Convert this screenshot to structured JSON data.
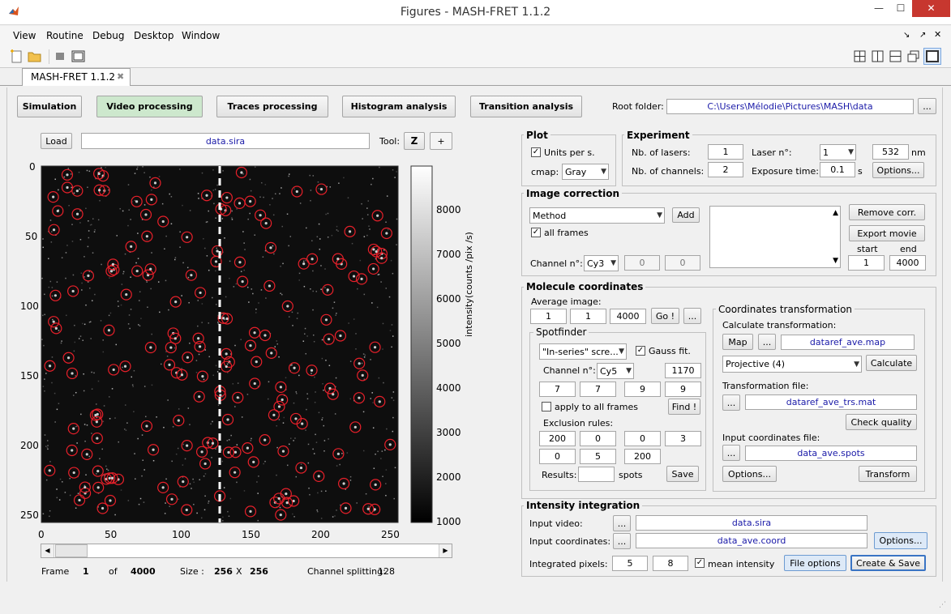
{
  "window": {
    "title": "Figures - MASH-FRET 1.1.2",
    "minimize": "—",
    "maximize": "☐",
    "close": "✕"
  },
  "menu": [
    "View",
    "Routine",
    "Debug",
    "Desktop",
    "Window"
  ],
  "document_tab": {
    "label": "MASH-FRET 1.1.2",
    "close": "✖"
  },
  "modules": {
    "items": [
      "Simulation",
      "Video processing",
      "Traces processing",
      "Histogram analysis",
      "Transition analysis"
    ],
    "selected": "Video processing",
    "root_label": "Root folder:",
    "root_value": "C:\\Users\\Mélodie\\Pictures\\MASH\\data",
    "root_browse": "..."
  },
  "viewer": {
    "load": "Load",
    "file": "data.sira",
    "tool_label": "Tool:",
    "tool_zoom": "Z",
    "tool_cross": "+",
    "y_ticks": [
      "0",
      "50",
      "100",
      "150",
      "200",
      "250"
    ],
    "x_ticks": [
      "0",
      "50",
      "100",
      "150",
      "200",
      "250"
    ],
    "colorbar_ticks": [
      "8000",
      "7000",
      "6000",
      "5000",
      "4000",
      "3000",
      "2000",
      "1000"
    ],
    "colorbar_label": "intensity(counts /pix /s)",
    "frame_label": "Frame",
    "frame_value": "1",
    "of_label": "of",
    "frame_total": "4000",
    "size_label": "Size :",
    "size_w": "256",
    "size_x": "X",
    "size_h": "256",
    "split_label": "Channel splitting:",
    "split_value": "128",
    "scroll_left": "◀",
    "scroll_right": "▶",
    "slider_position": 0.0
  },
  "plot": {
    "title": "Plot",
    "units_label": "Units per s.",
    "units_checked": "✓",
    "cmap_label": "cmap:",
    "cmap_value": "Gray"
  },
  "experiment": {
    "title": "Experiment",
    "lasers_label": "Nb. of lasers:",
    "lasers_value": "1",
    "laser_n_label": "Laser n°:",
    "laser_n_value": "1",
    "wavelength": "532",
    "nm": "nm",
    "channels_label": "Nb. of channels:",
    "channels_value": "2",
    "exposure_label": "Exposure time:",
    "exposure_value": "0.1",
    "s": "s",
    "options": "Options..."
  },
  "image_correction": {
    "title": "Image correction",
    "method": "Method",
    "add": "Add",
    "all_frames": "all frames",
    "all_frames_checked": "✓",
    "channel_label": "Channel n°:",
    "channel_value": "Cy3",
    "p1": "0",
    "p2": "0",
    "remove": "Remove corr.",
    "export": "Export movie",
    "start_label": "start",
    "end_label": "end",
    "start_value": "1",
    "end_value": "4000"
  },
  "molecule_coords": {
    "title": "Molecule coordinates",
    "avg_label": "Average image:",
    "avg_1": "1",
    "avg_2": "1",
    "avg_3": "4000",
    "go": "Go !",
    "browse": "...",
    "spotfinder": {
      "title": "Spotfinder",
      "method": "\"In-series\" scre...",
      "gauss": "Gauss fit.",
      "gauss_checked": "✓",
      "channel_label": "Channel n°:",
      "channel_value": "Cy5",
      "max_spots": "1170",
      "params": [
        "7",
        "7",
        "9",
        "9"
      ],
      "apply_all": "apply to all frames",
      "find": "Find !",
      "exclusion_label": "Exclusion rules:",
      "excl_row1": [
        "200",
        "0",
        "0",
        "3"
      ],
      "excl_row2": [
        "0",
        "5",
        "200"
      ],
      "results_label": "Results:",
      "results_value": "",
      "spots": "spots",
      "save": "Save"
    },
    "transform": {
      "title": "Coordinates transformation",
      "calc_label": "Calculate transformation:",
      "map": "Map",
      "map_browse": "...",
      "map_file": "dataref_ave.map",
      "type": "Projective (4)",
      "calculate": "Calculate",
      "tfile_label": "Transformation file:",
      "tfile_browse": "...",
      "tfile": "dataref_ave_trs.mat",
      "check": "Check quality",
      "input_label": "Input coordinates file:",
      "input_browse": "...",
      "input_file": "data_ave.spots",
      "options": "Options...",
      "transform": "Transform"
    }
  },
  "integration": {
    "title": "Intensity integration",
    "video_label": "Input video:",
    "video_browse": "...",
    "video_file": "data.sira",
    "coords_label": "Input coordinates:",
    "coords_browse": "...",
    "coords_file": "data_ave.coord",
    "options": "Options...",
    "pix_label": "Integrated pixels:",
    "pix_1": "5",
    "pix_2": "8",
    "mean": "mean intensity",
    "mean_checked": "✓",
    "file_options": "File options",
    "create_save": "Create & Save"
  }
}
